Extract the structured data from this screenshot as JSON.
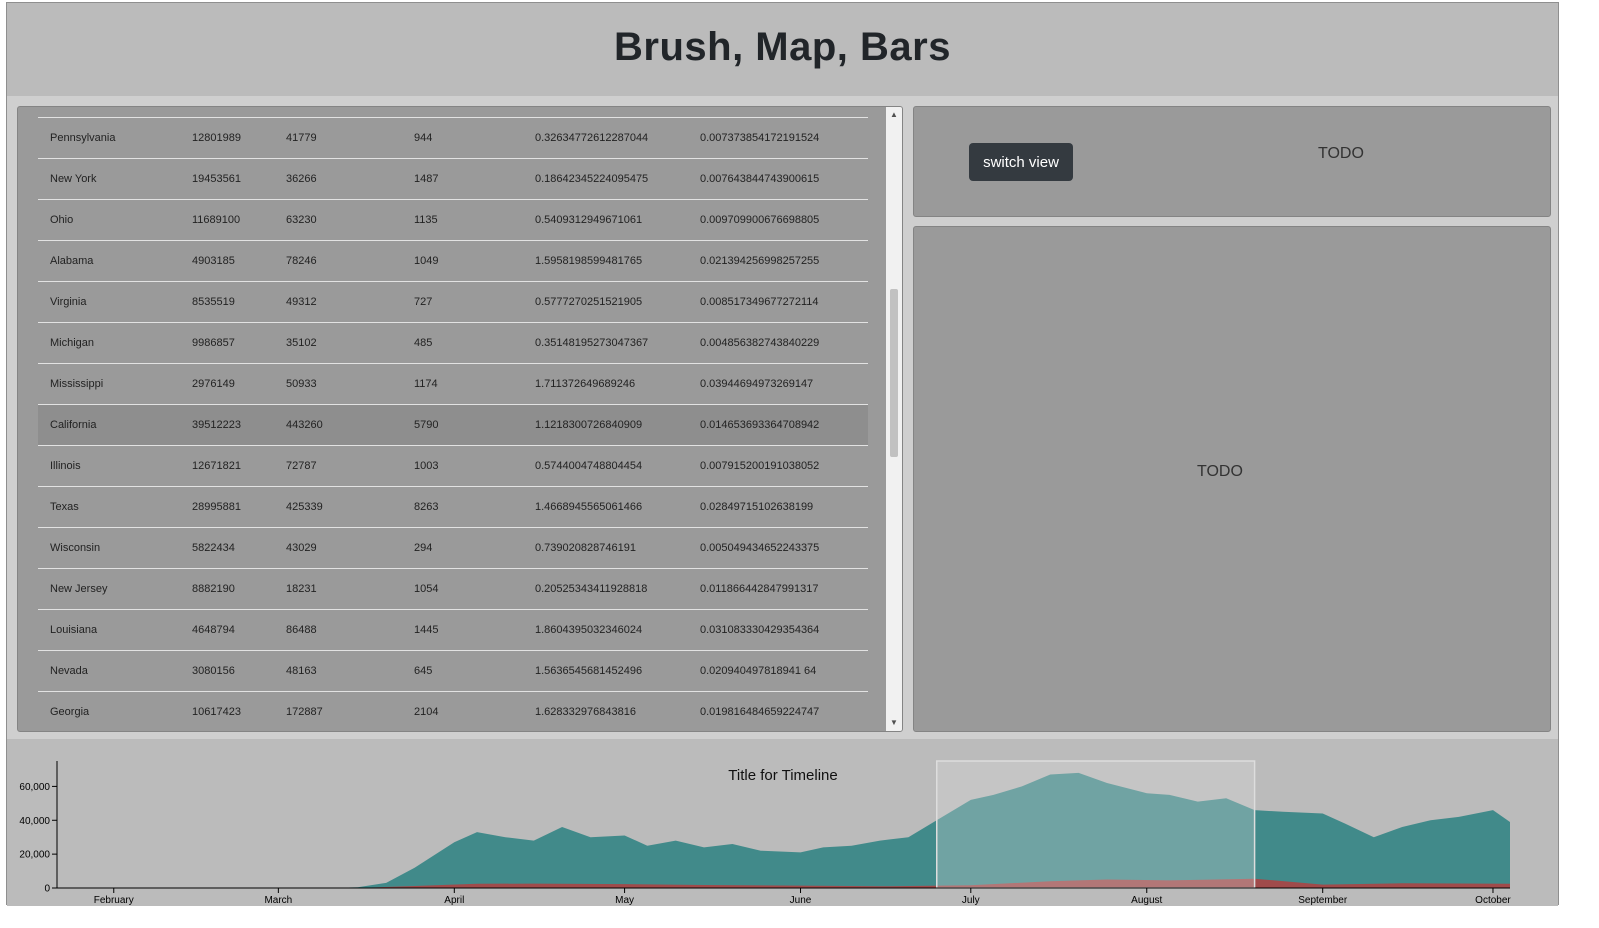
{
  "header": {
    "title": "Brush, Map, Bars"
  },
  "table": {
    "rows": [
      {
        "state": "Pennsylvania",
        "population": "12801989",
        "cases": "41779",
        "deaths": "944",
        "rate1": "0.32634772612287044",
        "rate2": "0.007373854172191524"
      },
      {
        "state": "New York",
        "population": "19453561",
        "cases": "36266",
        "deaths": "1487",
        "rate1": "0.18642345224095475",
        "rate2": "0.007643844743900615"
      },
      {
        "state": "Ohio",
        "population": "11689100",
        "cases": "63230",
        "deaths": "1135",
        "rate1": "0.5409312949671061",
        "rate2": "0.009709900676698805"
      },
      {
        "state": "Alabama",
        "population": "4903185",
        "cases": "78246",
        "deaths": "1049",
        "rate1": "1.5958198599481765",
        "rate2": "0.021394256998257255"
      },
      {
        "state": "Virginia",
        "population": "8535519",
        "cases": "49312",
        "deaths": "727",
        "rate1": "0.5777270251521905",
        "rate2": "0.008517349677272114"
      },
      {
        "state": "Michigan",
        "population": "9986857",
        "cases": "35102",
        "deaths": "485",
        "rate1": "0.35148195273047367",
        "rate2": "0.004856382743840229"
      },
      {
        "state": "Mississippi",
        "population": "2976149",
        "cases": "50933",
        "deaths": "1174",
        "rate1": "1.711372649689246",
        "rate2": "0.03944694973269147"
      },
      {
        "state": "California",
        "population": "39512223",
        "cases": "443260",
        "deaths": "5790",
        "rate1": "1.1218300726840909",
        "rate2": "0.014653693364708942"
      },
      {
        "state": "Illinois",
        "population": "12671821",
        "cases": "72787",
        "deaths": "1003",
        "rate1": "0.5744004748804454",
        "rate2": "0.007915200191038052"
      },
      {
        "state": "Texas",
        "population": "28995881",
        "cases": "425339",
        "deaths": "8263",
        "rate1": "1.4668945565061466",
        "rate2": "0.02849715102638199"
      },
      {
        "state": "Wisconsin",
        "population": "5822434",
        "cases": "43029",
        "deaths": "294",
        "rate1": "0.739020828746191",
        "rate2": "0.005049434652243375"
      },
      {
        "state": "New Jersey",
        "population": "8882190",
        "cases": "18231",
        "deaths": "1054",
        "rate1": "0.20525343411928818",
        "rate2": "0.011866442847991317"
      },
      {
        "state": "Louisiana",
        "population": "4648794",
        "cases": "86488",
        "deaths": "1445",
        "rate1": "1.8604395032346024",
        "rate2": "0.031083330429354364"
      },
      {
        "state": "Nevada",
        "population": "3080156",
        "cases": "48163",
        "deaths": "645",
        "rate1": "1.5636545681452496",
        "rate2": "0.020940497818941 64"
      },
      {
        "state": "Georgia",
        "population": "10617423",
        "cases": "172887",
        "deaths": "2104",
        "rate1": "1.628332976843816",
        "rate2": "0.019816484659224747"
      }
    ]
  },
  "top_panel": {
    "button_label": "switch view",
    "todo_text": "TODO"
  },
  "bottom_panel": {
    "todo_text": "TODO"
  },
  "timeline": {
    "title": "Title for Timeline",
    "y_ticks": [
      "0",
      "20,000",
      "40,000",
      "60,000"
    ],
    "x_ticks": [
      "February",
      "March",
      "April",
      "May",
      "June",
      "July",
      "August",
      "September",
      "October"
    ],
    "colors": {
      "cases": "#418a8a",
      "deaths": "#a04b4b",
      "brush": "#dddddd"
    },
    "brush": {
      "start": "2020-06-25",
      "end": "2020-08-20"
    }
  },
  "chart_data": {
    "type": "area",
    "title": "Title for Timeline",
    "xlabel": "",
    "ylabel": "",
    "ylim": [
      0,
      75000
    ],
    "x_range": [
      "2020-01-22",
      "2020-10-04"
    ],
    "grid": false,
    "series": [
      {
        "name": "",
        "color": "#418a8a",
        "x": [
          "2020-01-22",
          "2020-02-15",
          "2020-03-01",
          "2020-03-10",
          "2020-03-15",
          "2020-03-20",
          "2020-03-25",
          "2020-04-01",
          "2020-04-05",
          "2020-04-10",
          "2020-04-15",
          "2020-04-20",
          "2020-04-25",
          "2020-05-01",
          "2020-05-05",
          "2020-05-10",
          "2020-05-15",
          "2020-05-20",
          "2020-05-25",
          "2020-06-01",
          "2020-06-05",
          "2020-06-10",
          "2020-06-15",
          "2020-06-20",
          "2020-06-25",
          "2020-07-01",
          "2020-07-05",
          "2020-07-10",
          "2020-07-15",
          "2020-07-20",
          "2020-07-25",
          "2020-08-01",
          "2020-08-05",
          "2020-08-10",
          "2020-08-15",
          "2020-08-20",
          "2020-08-25",
          "2020-09-01",
          "2020-09-05",
          "2020-09-10",
          "2020-09-15",
          "2020-09-20",
          "2020-09-25",
          "2020-10-01",
          "2020-10-04"
        ],
        "values": [
          0,
          0,
          0,
          0,
          500,
          3000,
          12000,
          27000,
          33000,
          30000,
          28000,
          36000,
          30000,
          31000,
          25000,
          28000,
          24000,
          26000,
          22000,
          21000,
          24000,
          25000,
          28000,
          30000,
          40000,
          52000,
          55000,
          60000,
          67000,
          68000,
          62000,
          56000,
          55000,
          51000,
          53000,
          46000,
          45000,
          44000,
          38000,
          30000,
          36000,
          40000,
          42000,
          46000,
          39000
        ]
      },
      {
        "name": "",
        "color": "#a04b4b",
        "x": [
          "2020-01-22",
          "2020-03-15",
          "2020-03-25",
          "2020-04-05",
          "2020-04-15",
          "2020-05-01",
          "2020-05-15",
          "2020-06-01",
          "2020-06-15",
          "2020-07-01",
          "2020-07-15",
          "2020-07-25",
          "2020-08-05",
          "2020-08-20",
          "2020-09-01",
          "2020-09-15",
          "2020-10-04"
        ],
        "values": [
          0,
          0,
          1200,
          2500,
          2600,
          2300,
          1800,
          1400,
          1000,
          1600,
          4000,
          5000,
          4500,
          5500,
          2000,
          2800,
          2500
        ]
      }
    ]
  }
}
